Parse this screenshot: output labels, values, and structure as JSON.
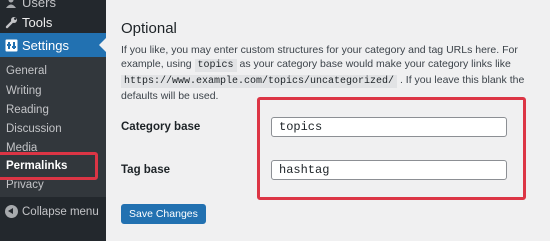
{
  "sidebar": {
    "items": [
      {
        "label": "Users",
        "icon": "users-icon"
      },
      {
        "label": "Tools",
        "icon": "wrench-icon"
      },
      {
        "label": "Settings",
        "icon": "settings-icon"
      }
    ],
    "submenu": [
      "General",
      "Writing",
      "Reading",
      "Discussion",
      "Media",
      "Permalinks",
      "Privacy"
    ],
    "current_submenu": "Permalinks",
    "collapse_label": "Collapse menu"
  },
  "main": {
    "section_title": "Optional",
    "description": {
      "part1": "If you like, you may enter custom structures for your category and tag URLs here. For example, using ",
      "code1": "topics",
      "part2": " as your category base would make your category links like ",
      "code2": "https://www.example.com/topics/uncategorized/",
      "part3": " . If you leave this blank the defaults will be used."
    },
    "fields": [
      {
        "label": "Category base",
        "value": "topics"
      },
      {
        "label": "Tag base",
        "value": "hashtag"
      }
    ],
    "save_button": "Save Changes"
  },
  "colors": {
    "sidebar_bg": "#23282d",
    "submenu_bg": "#32373c",
    "accent": "#2271b1",
    "highlight": "#dc3545"
  }
}
